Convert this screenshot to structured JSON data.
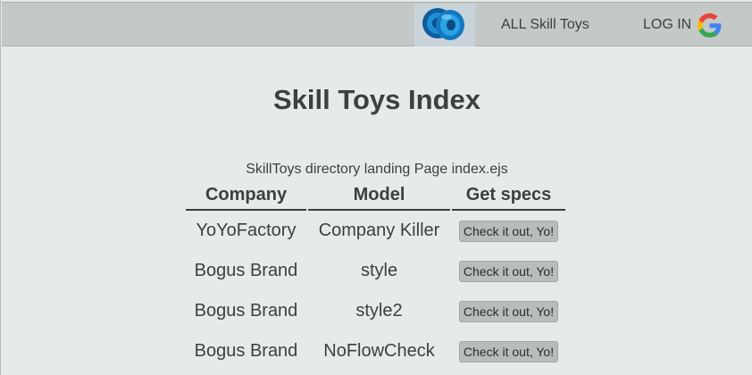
{
  "nav": {
    "logo_icon": "yoyo-logo",
    "all_link": "ALL Skill Toys",
    "login_link": "LOG IN",
    "login_icon": "google-icon"
  },
  "page": {
    "title": "Skill Toys Index",
    "subtitle": "SkillToys directory landing Page index.ejs"
  },
  "table": {
    "headers": [
      "Company",
      "Model",
      "Get specs"
    ],
    "rows": [
      {
        "company": "YoYoFactory",
        "model": "Company Killer",
        "button": "Check it out, Yo!"
      },
      {
        "company": "Bogus Brand",
        "model": "style",
        "button": "Check it out, Yo!"
      },
      {
        "company": "Bogus Brand",
        "model": "style2",
        "button": "Check it out, Yo!"
      },
      {
        "company": "Bogus Brand",
        "model": "NoFlowCheck",
        "button": "Check it out, Yo!"
      }
    ]
  },
  "colors": {
    "background": "#e6ebea",
    "nav_background": "#c4c9c8",
    "text": "#3c4040",
    "button_background": "#b8bdbc"
  }
}
